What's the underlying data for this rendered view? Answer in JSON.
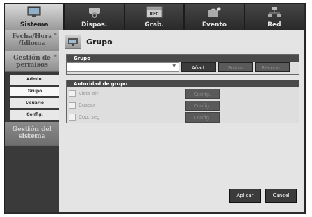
{
  "nav": {
    "tabs": [
      {
        "label": "Sistema",
        "icon": "monitor-icon"
      },
      {
        "label": "Dispos.",
        "icon": "camera-icon"
      },
      {
        "label": "Grab.",
        "icon": "rec-icon"
      },
      {
        "label": "Evento",
        "icon": "alarm-icon"
      },
      {
        "label": "Red",
        "icon": "network-icon"
      }
    ],
    "rec_badge": "REC"
  },
  "sidebar": {
    "fecha": "Fecha/Hora /Idioma",
    "gestion_permisos": "Gestión de permisos",
    "items": [
      "Admin.",
      "Grupo",
      "Usuario",
      "Config."
    ],
    "gestion_sistema": "Gestión del sistema"
  },
  "page": {
    "title": "Grupo"
  },
  "grupo": {
    "header": "Grupo",
    "select_value": "",
    "buttons": {
      "add": "Añad.",
      "delete": "Borrar",
      "rename": "Renomb."
    }
  },
  "autoridad": {
    "header": "Autoridad de grupo",
    "rows": [
      {
        "label": "Vista dir.",
        "config": "Config."
      },
      {
        "label": "Buscar",
        "config": "Config."
      },
      {
        "label": "Cop. seg",
        "config": "Config."
      }
    ]
  },
  "footer": {
    "apply": "Aplicar",
    "cancel": "Cancel"
  },
  "colors": {
    "frame": "#2c2c2c",
    "active_tab": "#cfcfcf",
    "content": "#e4e4e4",
    "button": "#3b3b3b"
  }
}
